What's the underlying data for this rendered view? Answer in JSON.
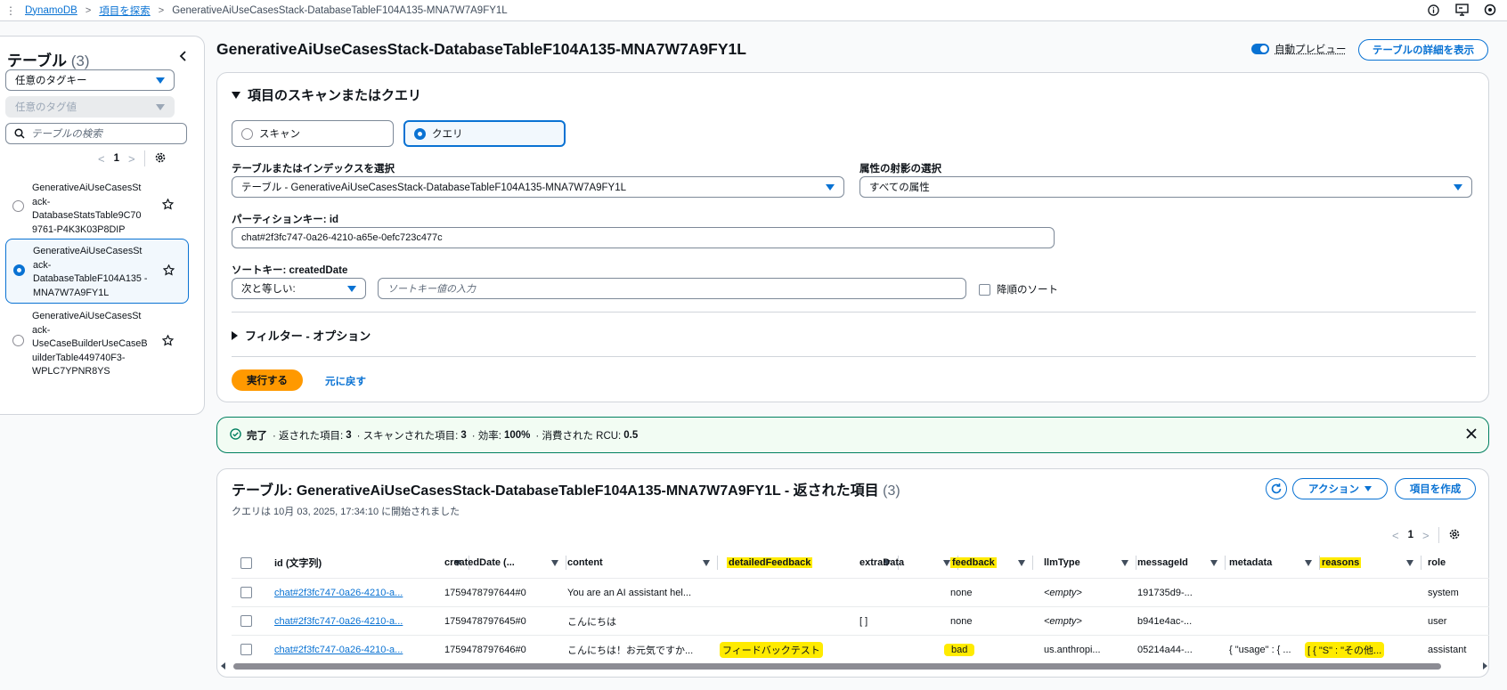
{
  "breadcrumb": {
    "items": [
      "DynamoDB",
      "項目を探索"
    ],
    "current": "GenerativeAiUseCasesStack-DatabaseTableF104A135-MNA7W7A9FY1L"
  },
  "sidebar": {
    "title": "テーブル",
    "count": "(3)",
    "tag_key_placeholder": "任意のタグキー",
    "tag_value_placeholder": "任意のタグ値",
    "search_placeholder": "テーブルの検索",
    "page": "1",
    "tables": [
      {
        "name": "GenerativeAiUseCasesSt ack-DatabaseStatsTable9C70 9761-P4K3K03P8DIP",
        "selected": false
      },
      {
        "name": "GenerativeAiUseCasesSt ack-DatabaseTableF104A135 -MNA7W7A9FY1L",
        "selected": true
      },
      {
        "name": "GenerativeAiUseCasesSt ack-UseCaseBuilderUseCaseB uilderTable449740F3-WPLC7YPNR8YS",
        "selected": false
      }
    ]
  },
  "header": {
    "title": "GenerativeAiUseCasesStack-DatabaseTableF104A135-MNA7W7A9FY1L",
    "auto_preview_label": "自動プレビュー",
    "details_button": "テーブルの詳細を表示"
  },
  "query_panel": {
    "title": "項目のスキャンまたはクエリ",
    "scan_label": "スキャン",
    "query_label": "クエリ",
    "table_index_label": "テーブルまたはインデックスを選択",
    "table_index_value": "テーブル - GenerativeAiUseCasesStack-DatabaseTableF104A135-MNA7W7A9FY1L",
    "projection_label": "属性の射影の選択",
    "projection_value": "すべての属性",
    "partition_key_label": "パーティションキー: id",
    "partition_key_value": "chat#2f3fc747-0a26-4210-a65e-0efc723c477c",
    "sort_key_label": "ソートキー: createdDate",
    "sort_condition": "次と等しい:",
    "sort_value_placeholder": "ソートキー値の入力",
    "descending_label": "降順のソート",
    "filter_label": "フィルター - オプション",
    "run_button": "実行する",
    "reset_button": "元に戻す"
  },
  "status": {
    "complete": "完了",
    "returned_label": "· 返された項目:",
    "returned_value": "3",
    "scanned_label": "· スキャンされた項目:",
    "scanned_value": "3",
    "efficiency_label": "· 効率:",
    "efficiency_value": "100%",
    "rcu_label": "· 消費された RCU:",
    "rcu_value": "0.5"
  },
  "results": {
    "title": "テーブル: GenerativeAiUseCasesStack-DatabaseTableF104A135-MNA7W7A9FY1L - 返された項目",
    "count": "(3)",
    "subtitle": "クエリは 10月 03, 2025, 17:34:10 に開始されました",
    "actions_button": "アクション",
    "create_button": "項目を作成",
    "page": "1",
    "columns": [
      "id (文字列)",
      "createdDate (...",
      "content",
      "detailedFeedback",
      "extraData",
      "feedback",
      "llmType",
      "messageId",
      "metadata",
      "reasons",
      "role"
    ],
    "rows": [
      [
        "chat#2f3fc747-0a26-4210-a...",
        "1759478797644#0",
        "You are an AI assistant hel...",
        "",
        "",
        "none",
        "<empty>",
        "191735d9-...",
        "",
        "",
        "system"
      ],
      [
        "chat#2f3fc747-0a26-4210-a...",
        "1759478797645#0",
        "こんにちは",
        "",
        "[ ]",
        "none",
        "<empty>",
        "b941e4ac-...",
        "",
        "",
        "user"
      ],
      [
        "chat#2f3fc747-0a26-4210-a...",
        "1759478797646#0",
        "こんにちは！お元気ですか...",
        "フィードバックテスト",
        "",
        "bad",
        "us.anthropi...",
        "05214a44-...",
        "{ \"usage\" : { ...",
        "[ { \"S\" : \"その他...",
        "assistant"
      ]
    ]
  },
  "colors": {
    "accent": "#0972d3",
    "primary_button": "#ff9900",
    "highlight": "#ffeb00",
    "success": "#007f5f"
  }
}
